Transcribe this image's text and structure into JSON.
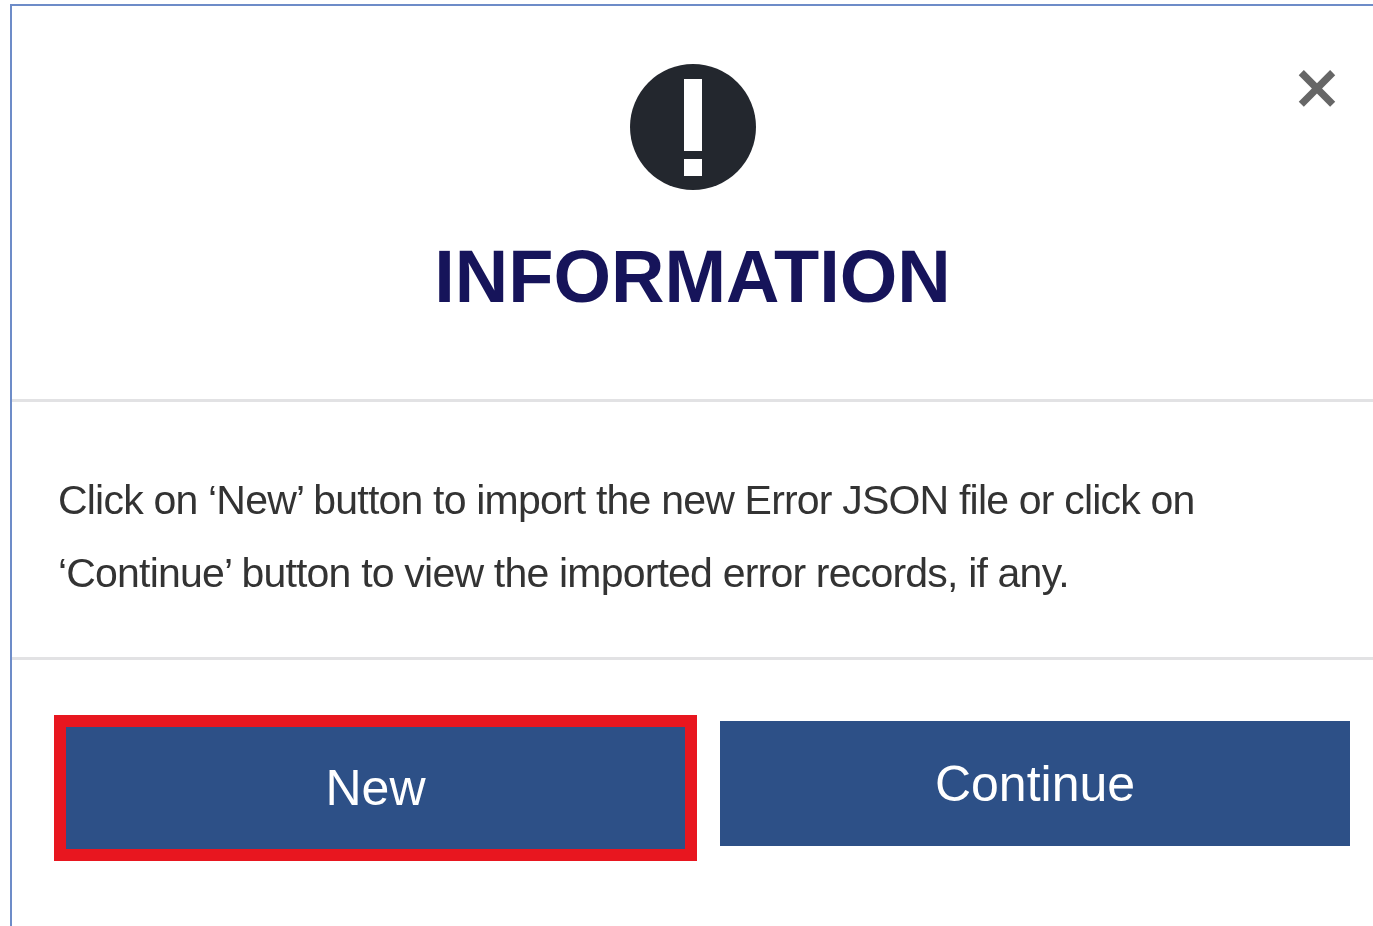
{
  "dialog": {
    "title": "INFORMATION",
    "close": "×",
    "message": "Click on ‘New’ button to import the new Error JSON file or click on ‘Continue’ button to view the imported error records, if any.",
    "buttons": [
      {
        "label": "New",
        "highlighted": true
      },
      {
        "label": "Continue",
        "highlighted": false
      }
    ]
  }
}
